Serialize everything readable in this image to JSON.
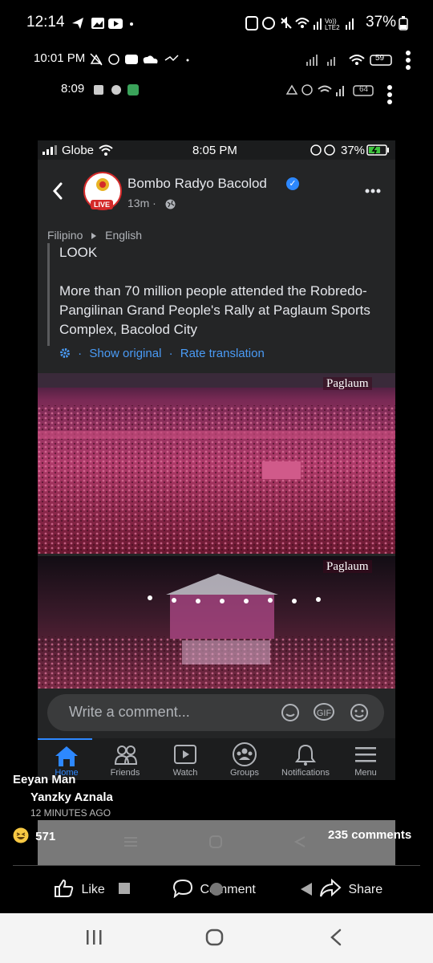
{
  "outer_status": {
    "time": "12:14",
    "battery": "37%"
  },
  "status2": {
    "time": "10:01 PM",
    "battery": "59"
  },
  "status3": {
    "time": "8:09",
    "battery": "64"
  },
  "inner_status": {
    "carrier": "Globe",
    "time": "8:05 PM",
    "battery": "37%"
  },
  "post": {
    "logo_text": "BOMBO RADYO BACOLOD",
    "live_badge": "LIVE",
    "page_name": "Bombo Radyo Bacolod",
    "verified_mark": "✓",
    "time": "13m ·",
    "lang_from": "Filipino",
    "lang_to": "English",
    "look": "LOOK",
    "body": "More than 70 million people attended the Robredo-Pangilinan Grand People's Rally at Paglaum Sports Complex, Bacolod City",
    "show_original": "Show original",
    "rate_translation": "Rate translation",
    "photo_brand_1": "Paglaum",
    "photo_brand_2": "Paglaum"
  },
  "composer": {
    "placeholder": "Write a comment...",
    "gif": "GIF"
  },
  "tabs": [
    {
      "label": "Home"
    },
    {
      "label": "Friends"
    },
    {
      "label": "Watch"
    },
    {
      "label": "Groups"
    },
    {
      "label": "Notifications"
    },
    {
      "label": "Menu"
    }
  ],
  "context": {
    "sharer": "Eeyan Man",
    "author": "Yanzky Aznala",
    "time_ago": "12 MINUTES AGO",
    "reaction_count": "571",
    "comment_count": "235 comments"
  },
  "actions": {
    "like": "Like",
    "comment": "Comment",
    "share": "Share"
  },
  "colors": {
    "accent": "#2d88ff",
    "live": "#d42a2a",
    "crowd": "#b03a6a"
  }
}
